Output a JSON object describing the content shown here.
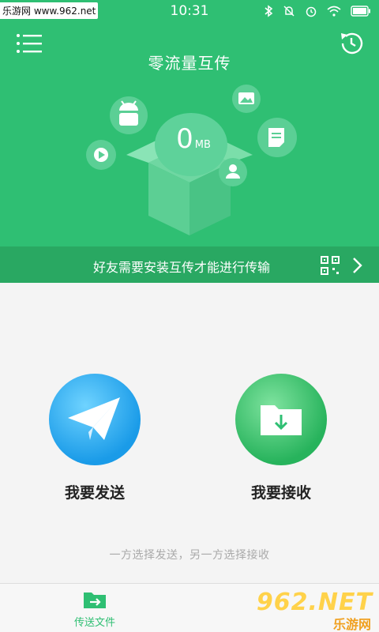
{
  "status_bar": {
    "time": "10:31",
    "icons": [
      "bluetooth-icon",
      "mute-icon",
      "alarm-icon",
      "wifi-icon",
      "battery-icon"
    ],
    "watermark": "乐游网 www.962.net"
  },
  "header": {
    "title": "零流量互传",
    "transfer_amount": "0",
    "transfer_unit": "MB",
    "menu_icon": "menu-icon",
    "history_icon": "history-icon"
  },
  "tip_bar": {
    "text": "好友需要安装互传才能进行传输",
    "qr_icon": "qr-code-icon",
    "chevron_icon": "chevron-right-icon"
  },
  "actions": {
    "send_label": "我要发送",
    "receive_label": "我要接收"
  },
  "hint": "一方选择发送，另一方选择接收",
  "tabbar": {
    "tab_label": "传送文件"
  },
  "logo": {
    "main": "962.NET",
    "sub": "乐游网"
  },
  "colors": {
    "primary_green": "#2fbf73",
    "tip_bar_green": "#29a862",
    "send_blue": "#1a9be8",
    "receive_green": "#27b35c"
  }
}
